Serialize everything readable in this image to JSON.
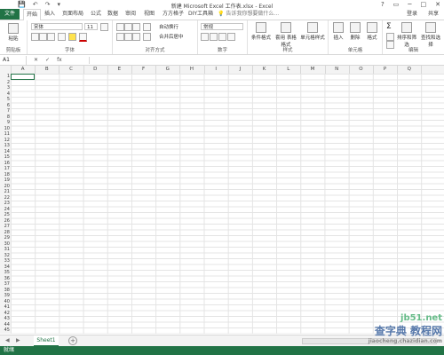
{
  "window": {
    "title": "新建 Microsoft Excel 工作表.xlsx - Excel",
    "qat": [
      "save-icon",
      "undo-icon",
      "redo-icon",
      "customize-icon"
    ],
    "buttons": [
      "?",
      "▭",
      "─",
      "□",
      "✕"
    ]
  },
  "tabs": [
    "文件",
    "开始",
    "插入",
    "页面布局",
    "公式",
    "数据",
    "审阅",
    "视图",
    "方方格子",
    "DIY工具箱"
  ],
  "tell_me": "告诉我你想要做什么...",
  "user": "登录",
  "share": "共享",
  "ribbon": {
    "clipboard": {
      "paste": "粘贴",
      "label": "剪贴板"
    },
    "font": {
      "name": "宋体",
      "size": "11",
      "label": "字体"
    },
    "alignment": {
      "wrap": "自动换行",
      "merge": "合并后居中",
      "label": "对齐方式"
    },
    "number": {
      "format": "常规",
      "label": "数字"
    },
    "styles": {
      "cond": "条件格式",
      "table": "套用\n表格格式",
      "cell": "单元格样式",
      "label": "样式"
    },
    "cells": {
      "insert": "插入",
      "delete": "删除",
      "format": "格式",
      "label": "单元格"
    },
    "editing": {
      "sum": "Σ",
      "sort": "排序和筛选",
      "find": "查找和选择",
      "label": "编辑"
    }
  },
  "formula_bar": {
    "name_box": "A1",
    "fx": "fx"
  },
  "columns": [
    "A",
    "B",
    "C",
    "D",
    "E",
    "F",
    "G",
    "H",
    "I",
    "J",
    "K",
    "L",
    "M",
    "N",
    "O",
    "P",
    "Q"
  ],
  "rows": [
    "1",
    "2",
    "3",
    "4",
    "5",
    "6",
    "7",
    "8",
    "9",
    "10",
    "11",
    "12",
    "13",
    "14",
    "15",
    "16",
    "17",
    "18",
    "19",
    "20",
    "21",
    "22",
    "23",
    "24",
    "25",
    "26",
    "27",
    "28",
    "29",
    "30",
    "31",
    "32",
    "33",
    "34",
    "35",
    "36",
    "37",
    "38",
    "39",
    "40",
    "41",
    "42",
    "43",
    "44",
    "45"
  ],
  "sheet": {
    "tab": "Sheet1",
    "add": "+"
  },
  "status": {
    "left": "就绪"
  },
  "watermark": {
    "line1": "jb51.net",
    "line2": "查字典 教程网",
    "line3": "jiaocheng.chazidian.com"
  }
}
